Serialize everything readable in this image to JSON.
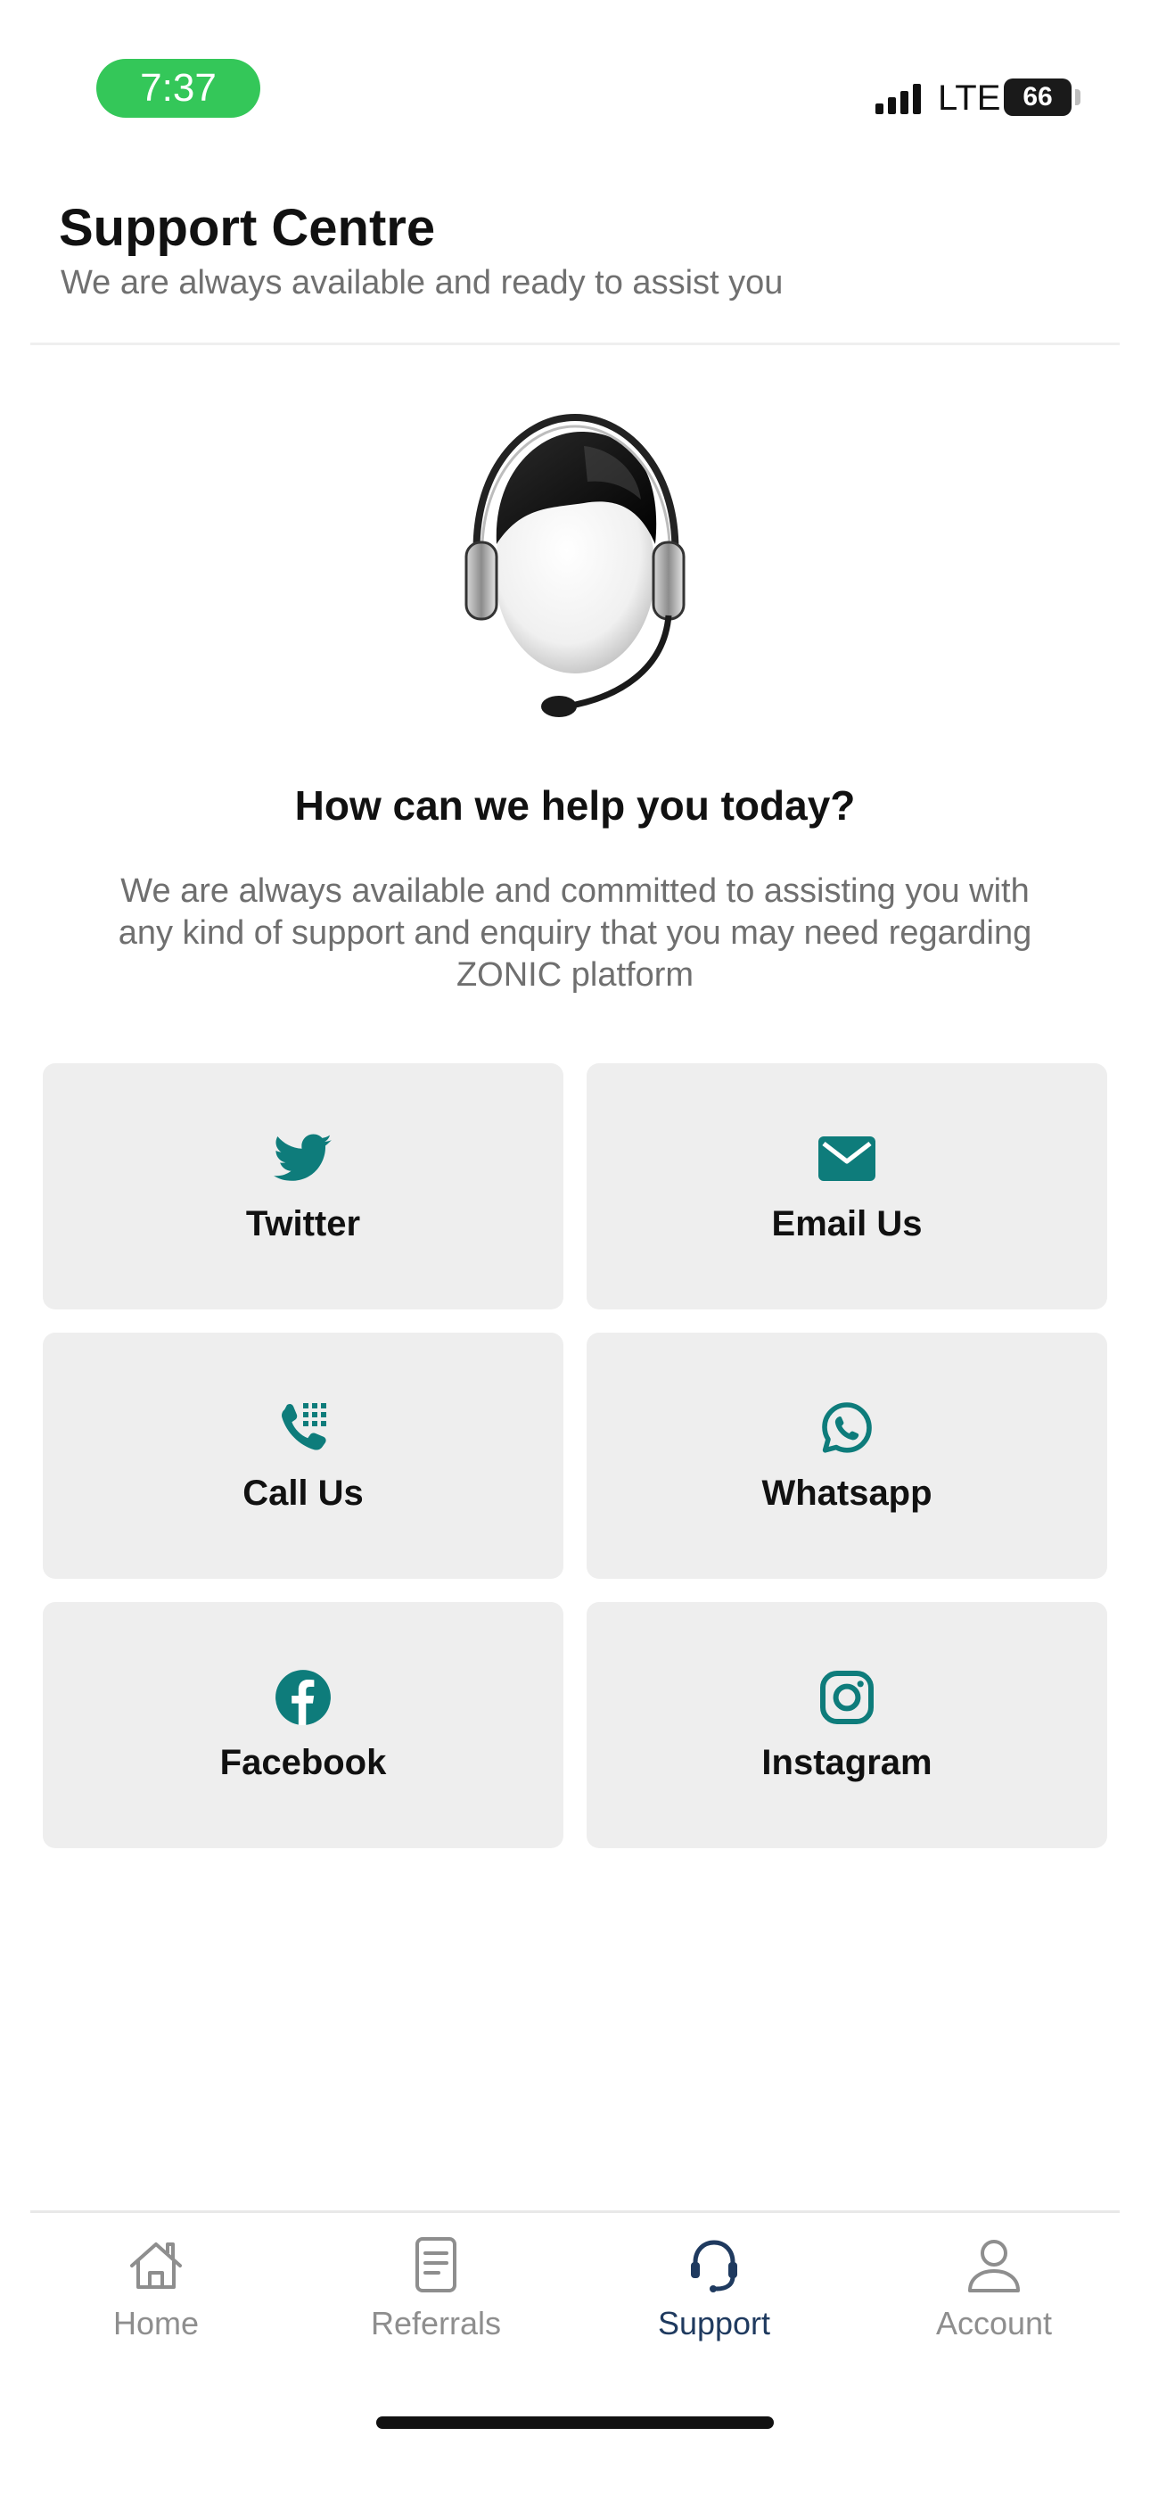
{
  "status_bar": {
    "time": "7:37",
    "network": "LTE",
    "battery": "66"
  },
  "header": {
    "title": "Support Centre",
    "subtitle": "We are always available and ready to assist you"
  },
  "main": {
    "illustration_icon": "headset-agent-icon",
    "heading": "How can we help you today?",
    "description": "We are always available and committed to assisting you with any kind of support and enquiry that you may need regarding ZONIC platform"
  },
  "contact_options": [
    {
      "label": "Twitter",
      "icon": "twitter-icon"
    },
    {
      "label": "Email Us",
      "icon": "email-icon"
    },
    {
      "label": "Call Us",
      "icon": "phone-dialpad-icon"
    },
    {
      "label": "Whatsapp",
      "icon": "whatsapp-icon"
    },
    {
      "label": "Facebook",
      "icon": "facebook-icon"
    },
    {
      "label": "Instagram",
      "icon": "instagram-icon"
    }
  ],
  "bottom_nav": {
    "items": [
      {
        "label": "Home",
        "icon": "home-icon"
      },
      {
        "label": "Referrals",
        "icon": "document-icon"
      },
      {
        "label": "Support",
        "icon": "headset-icon",
        "active": true
      },
      {
        "label": "Account",
        "icon": "user-icon"
      }
    ]
  },
  "colors": {
    "accent_teal": "#0e7c7b",
    "active_nav": "#1f3a5f",
    "status_pill": "#34c759",
    "card_background": "#eeeeee"
  }
}
